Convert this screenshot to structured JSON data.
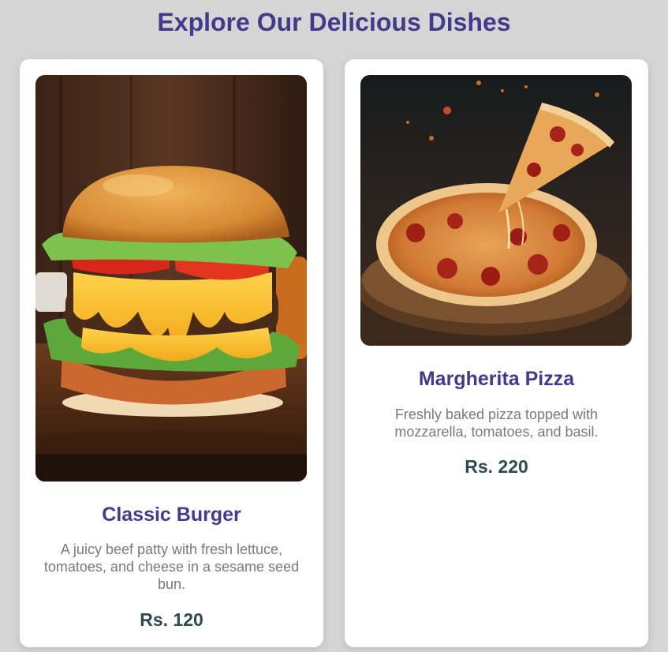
{
  "header": {
    "title": "Explore Our Delicious Dishes"
  },
  "dishes": [
    {
      "name": "Classic Burger",
      "description": "A juicy beef patty with fresh lettuce, tomatoes, and cheese in a sesame seed bun.",
      "price": "Rs. 120"
    },
    {
      "name": "Margherita Pizza",
      "description": "Freshly baked pizza topped with mozzarella, tomatoes, and basil.",
      "price": "Rs. 220"
    }
  ],
  "colors": {
    "background": "#d5d5d5",
    "title": "#433a8c",
    "description": "#7a7a7a",
    "price": "#2f4a4f",
    "card": "#ffffff"
  }
}
